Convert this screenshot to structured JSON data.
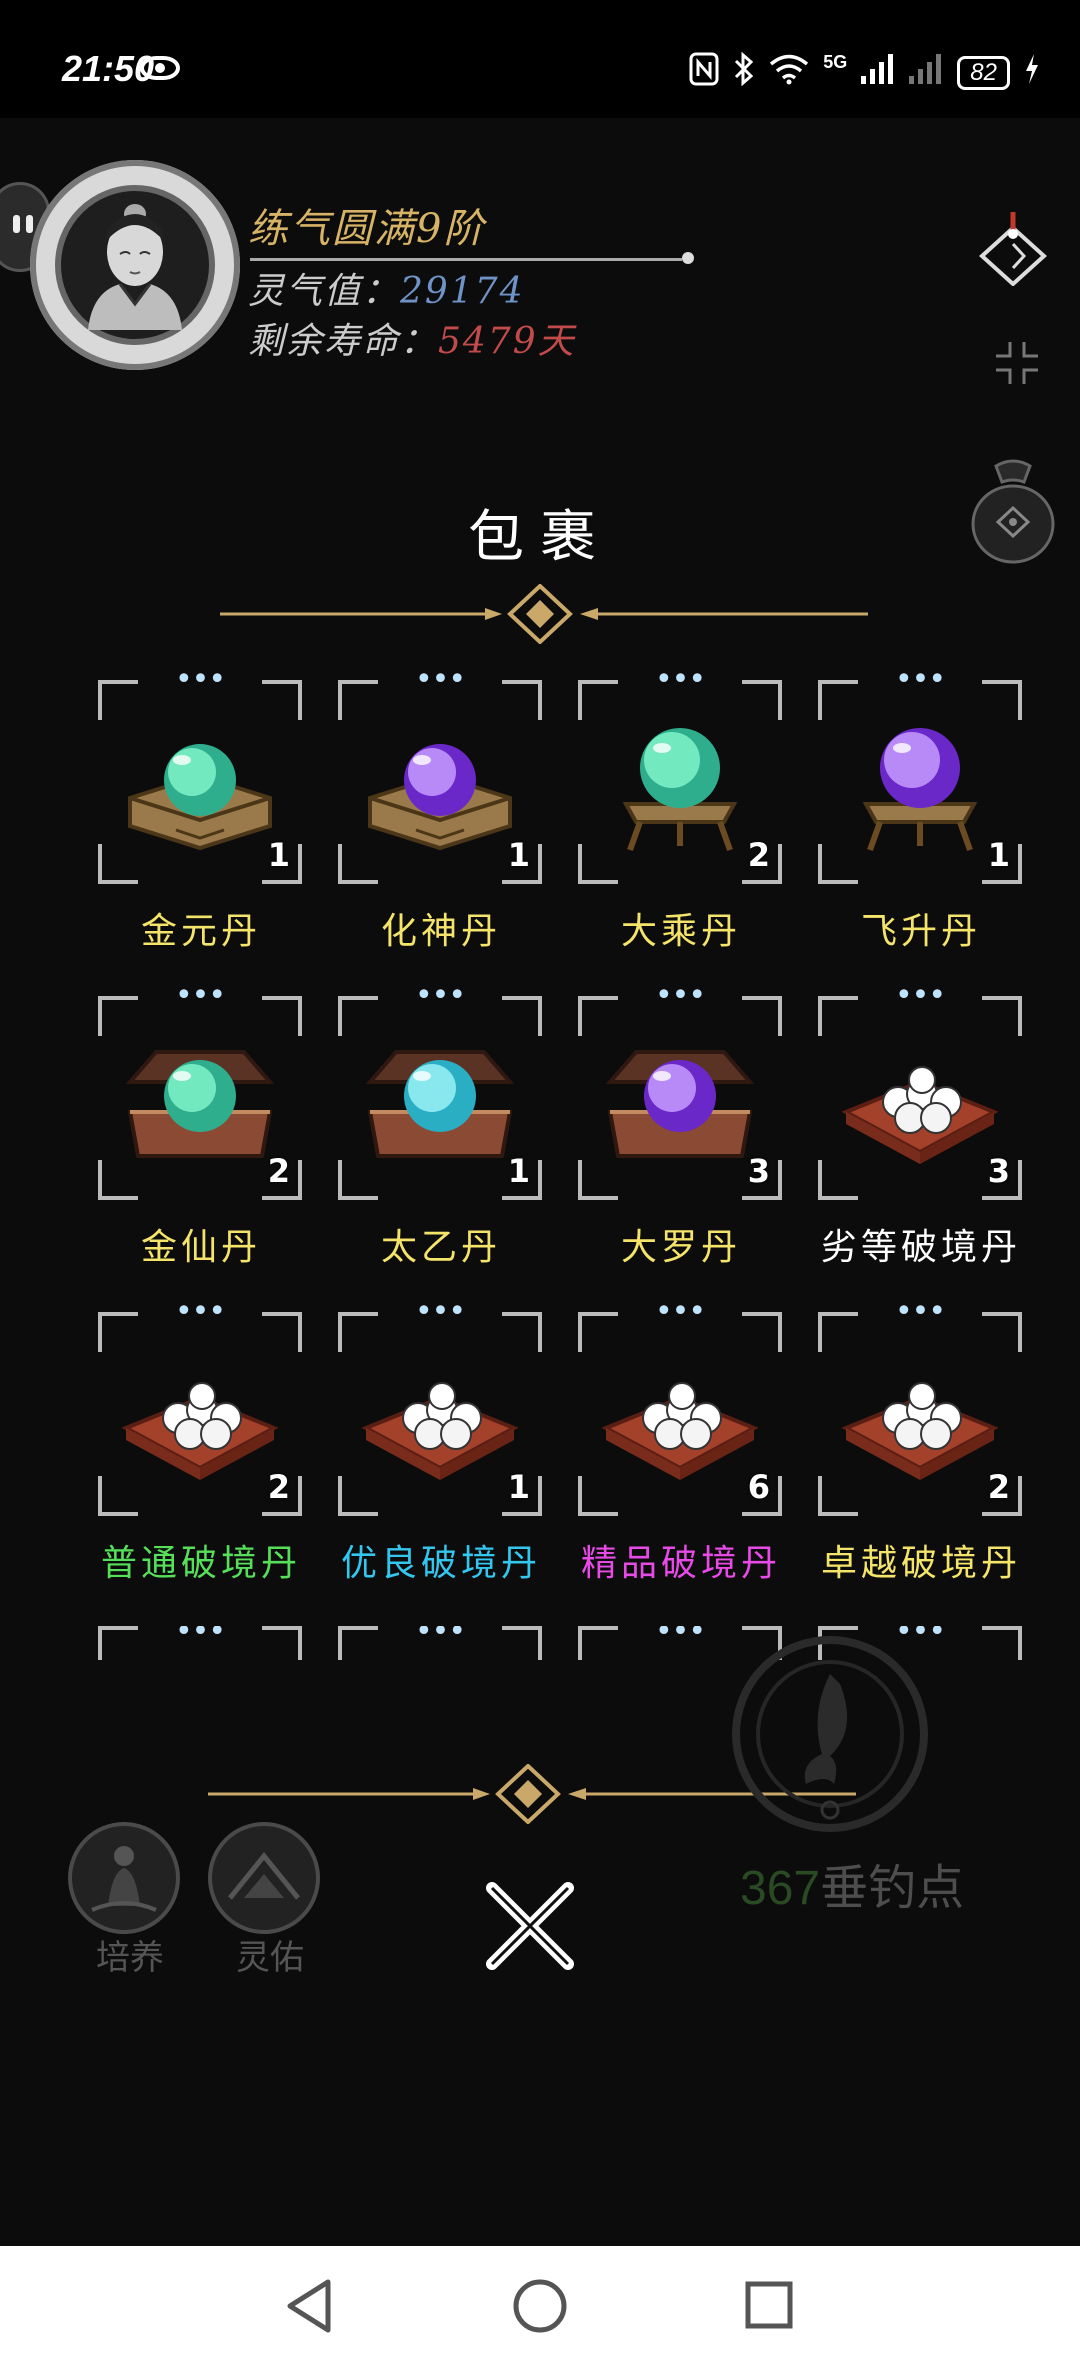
{
  "status_bar": {
    "time": "21:50",
    "network": "5G",
    "battery": "82"
  },
  "player": {
    "realm": "练气圆满9阶",
    "spirit_label": "灵气值：",
    "spirit_value": "29174",
    "lifespan_label": "剩余寿命：",
    "lifespan_value": "5479天"
  },
  "panel": {
    "title": "包裹"
  },
  "items": [
    {
      "name": "金元丹",
      "count": "1",
      "art": "green-orb-box",
      "color": "#f5e46a"
    },
    {
      "name": "化神丹",
      "count": "1",
      "art": "purple-orb-box",
      "color": "#f5e46a"
    },
    {
      "name": "大乘丹",
      "count": "2",
      "art": "green-orb-stand",
      "color": "#f5e46a"
    },
    {
      "name": "飞升丹",
      "count": "1",
      "art": "purple-orb-stand",
      "color": "#f5e46a"
    },
    {
      "name": "金仙丹",
      "count": "2",
      "art": "green-orb-chest",
      "color": "#f5e46a"
    },
    {
      "name": "太乙丹",
      "count": "1",
      "art": "cyan-orb-chest",
      "color": "#f5e46a"
    },
    {
      "name": "大罗丹",
      "count": "3",
      "art": "purple-orb-chest",
      "color": "#f5e46a"
    },
    {
      "name": "劣等破境丹",
      "count": "3",
      "art": "pills-cushion",
      "color": "#ffffff"
    },
    {
      "name": "普通破境丹",
      "count": "2",
      "art": "pills-cushion",
      "color": "#56e05a"
    },
    {
      "name": "优良破境丹",
      "count": "1",
      "art": "pills-cushion",
      "color": "#33c7f0"
    },
    {
      "name": "精品破境丹",
      "count": "6",
      "art": "pills-cushion",
      "color": "#e84ae8"
    },
    {
      "name": "卓越破境丹",
      "count": "2",
      "art": "pills-cushion",
      "color": "#f5e46a"
    }
  ],
  "bottom": {
    "cultivate_label": "培养",
    "blessing_label": "灵佑",
    "fishing_points_value": "367",
    "fishing_points_label": "垂钓点"
  }
}
